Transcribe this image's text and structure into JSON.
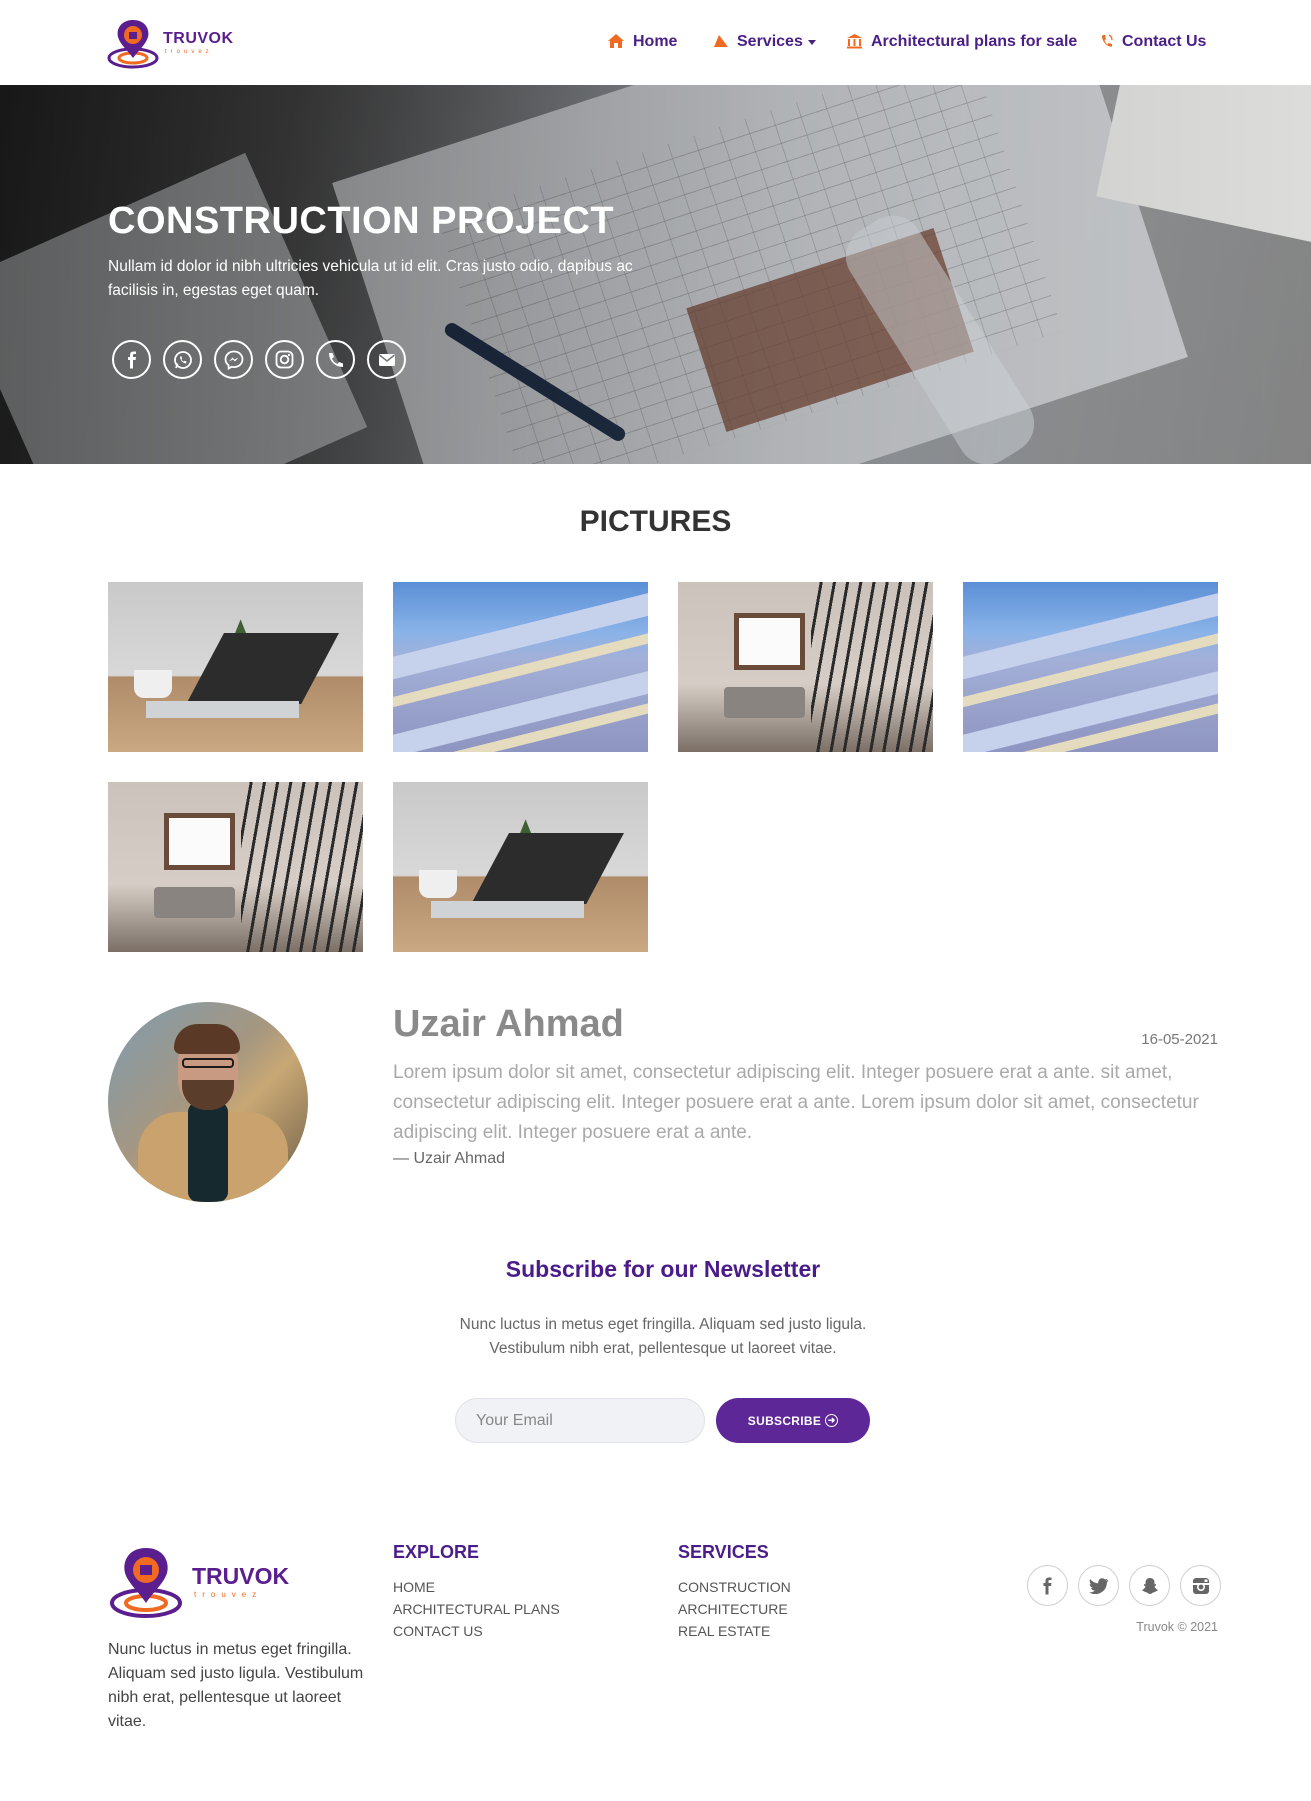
{
  "brand": {
    "name": "TRUVOK",
    "tagline": "trouvez",
    "primary_color": "#4a1c8a",
    "accent_color": "#f06a22"
  },
  "nav": {
    "items": [
      {
        "label": "Home",
        "icon": "home-icon"
      },
      {
        "label": "Services",
        "icon": "pyramid-icon",
        "dropdown": true
      },
      {
        "label": "Architectural plans for sale",
        "icon": "bank-icon"
      },
      {
        "label": "Contact Us",
        "icon": "phone-ring-icon"
      }
    ]
  },
  "hero": {
    "title": "CONSTRUCTION PROJECT",
    "text": "Nullam id dolor id nibh ultricies vehicula ut id elit. Cras justo odio, dapibus ac facilisis in, egestas eget quam.",
    "socials": [
      "facebook-icon",
      "whatsapp-icon",
      "messenger-icon",
      "instagram-icon",
      "phone-icon",
      "mail-icon"
    ]
  },
  "pictures": {
    "title": "PICTURES",
    "images": [
      "laptop-desk",
      "building-facade",
      "staircase-loft",
      "building-facade",
      "staircase-loft",
      "laptop-desk"
    ]
  },
  "author": {
    "name": "Uzair Ahmad",
    "date": "16-05-2021",
    "quote": "Lorem ipsum dolor sit amet, consectetur adipiscing elit. Integer posuere erat a ante. sit amet, consectetur adipiscing elit. Integer posuere erat a ante. Lorem ipsum dolor sit amet, consectetur adipiscing elit. Integer posuere erat a ante.",
    "cite": "— Uzair Ahmad"
  },
  "newsletter": {
    "title": "Subscribe for our Newsletter",
    "text": "Nunc luctus in metus eget fringilla. Aliquam sed justo ligula. Vestibulum nibh erat, pellentesque ut laoreet vitae.",
    "placeholder": "Your Email",
    "button": "SUBSCRIBE"
  },
  "footer": {
    "about": "Nunc luctus in metus eget fringilla. Aliquam sed justo ligula. Vestibulum nibh erat, pellentesque ut laoreet vitae.",
    "explore": {
      "title": "EXPLORE",
      "links": [
        "HOME",
        "ARCHITECTURAL PLANS",
        "CONTACT US"
      ]
    },
    "services": {
      "title": "SERVICES",
      "links": [
        "CONSTRUCTION",
        "ARCHITECTURE",
        "REAL ESTATE"
      ]
    },
    "socials": [
      "facebook-icon",
      "twitter-icon",
      "snapchat-icon",
      "instagram-icon"
    ],
    "copyright": "Truvok © 2021"
  }
}
